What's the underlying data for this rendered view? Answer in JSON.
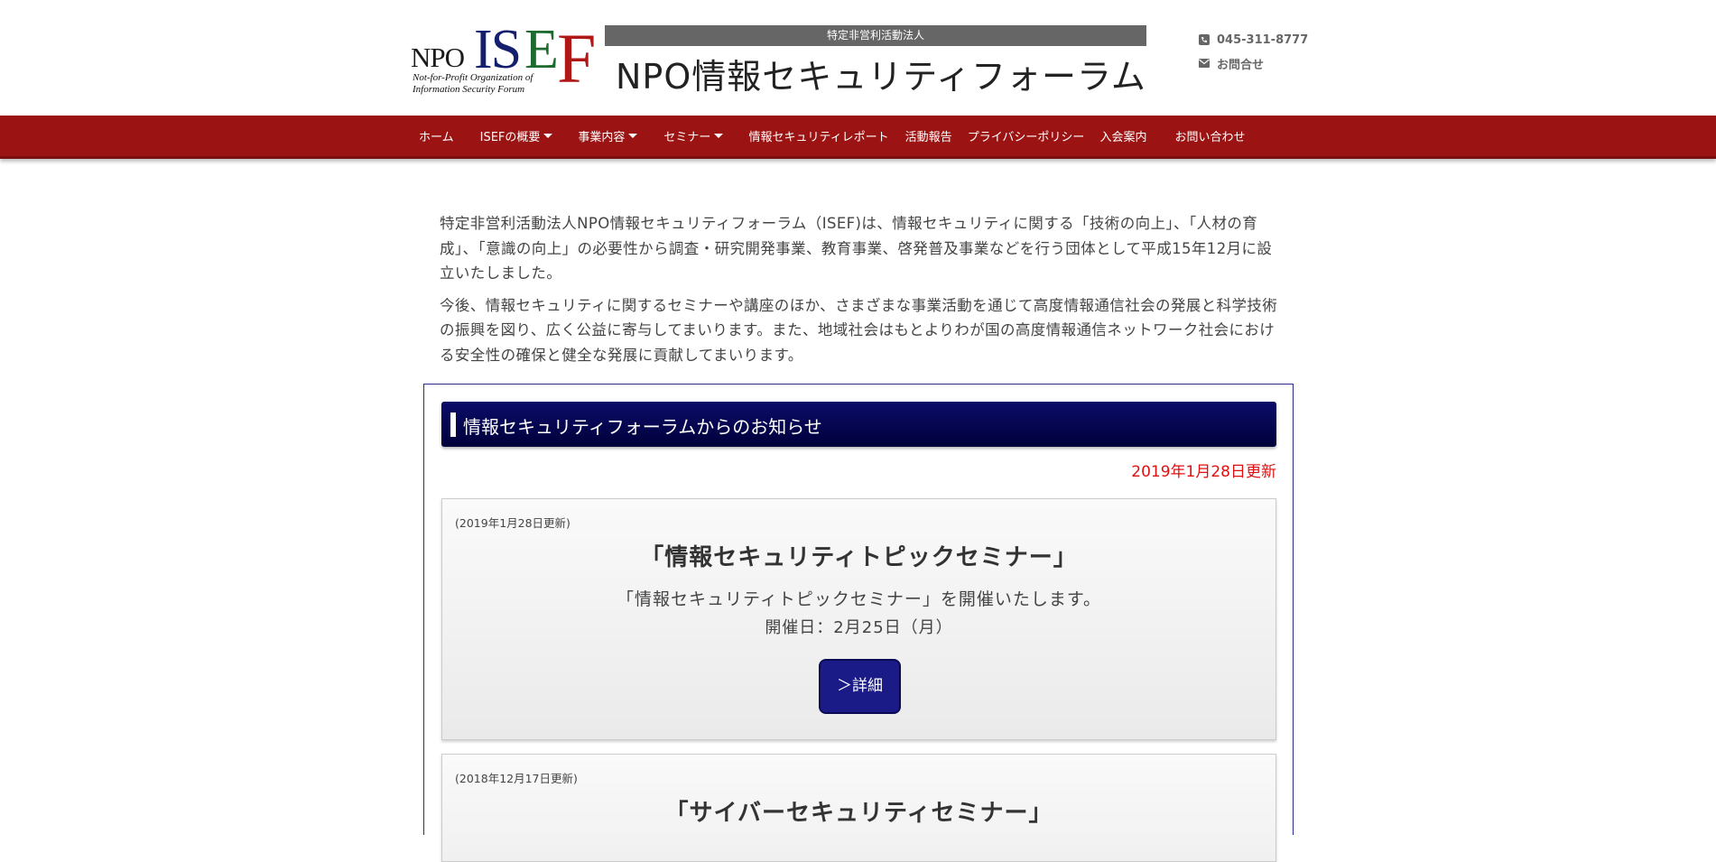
{
  "header": {
    "logo": {
      "npo": "NPO",
      "is": "IS",
      "e": "E",
      "f": "F",
      "subtitle_line1": "Not-for-Profit Organization of",
      "subtitle_line2": "Information Security Forum"
    },
    "org_type": "特定非営利活動法人",
    "org_name": "NPO情報セキュリティフォーラム",
    "phone": "045-311-8777",
    "contact_link": "お問合せ",
    "icons": {
      "phone": "phone-icon",
      "mail": "envelope-icon"
    }
  },
  "nav": {
    "items": [
      {
        "label": "ホーム",
        "dropdown": false
      },
      {
        "label": "ISEFの概要",
        "dropdown": true
      },
      {
        "label": "事業内容",
        "dropdown": true
      },
      {
        "label": "セミナー",
        "dropdown": true
      },
      {
        "label": "情報セキュリティレポート",
        "dropdown": false
      },
      {
        "label": "活動報告",
        "dropdown": false
      },
      {
        "label": "プライバシーポリシー",
        "dropdown": false
      },
      {
        "label": "入会案内",
        "dropdown": false
      },
      {
        "label": "お問い合わせ",
        "dropdown": false
      }
    ]
  },
  "intro": {
    "p1": "特定非営利活動法人NPO情報セキュリティフォーラム（ISEF)は、情報セキュリティに関する「技術の向上」、「人材の育成」、「意識の向上」の必要性から調査・研究開発事業、教育事業、啓発普及事業などを行う団体として平成15年12月に設立いたしました。",
    "p2": "今後、情報セキュリティに関するセミナーや講座のほか、さまざまな事業活動を通じて高度情報通信社会の発展と科学技術の振興を図り、広く公益に寄与してまいります。また、地域社会はもとよりわが国の高度情報通信ネットワーク社会における安全性の確保と健全な発展に貢献してまいります。"
  },
  "news": {
    "title": "情報セキュリティフォーラムからのお知らせ",
    "updated": "2019年1月28日更新",
    "cards": [
      {
        "date": "(2019年1月28日更新)",
        "title": "「情報セキュリティトピックセミナー」",
        "desc": "「情報セキュリティトピックセミナー」を開催いたします。",
        "event_date": "開催日：2月25日（月）",
        "button": "＞詳細"
      },
      {
        "date": "(2018年12月17日更新)",
        "title": "「サイバーセキュリティセミナー」"
      }
    ]
  },
  "colors": {
    "nav_bg": "#9b1313",
    "news_header_bg": "#0c0c6a",
    "updated_text": "#e01010",
    "button_bg": "#1b1b88"
  }
}
